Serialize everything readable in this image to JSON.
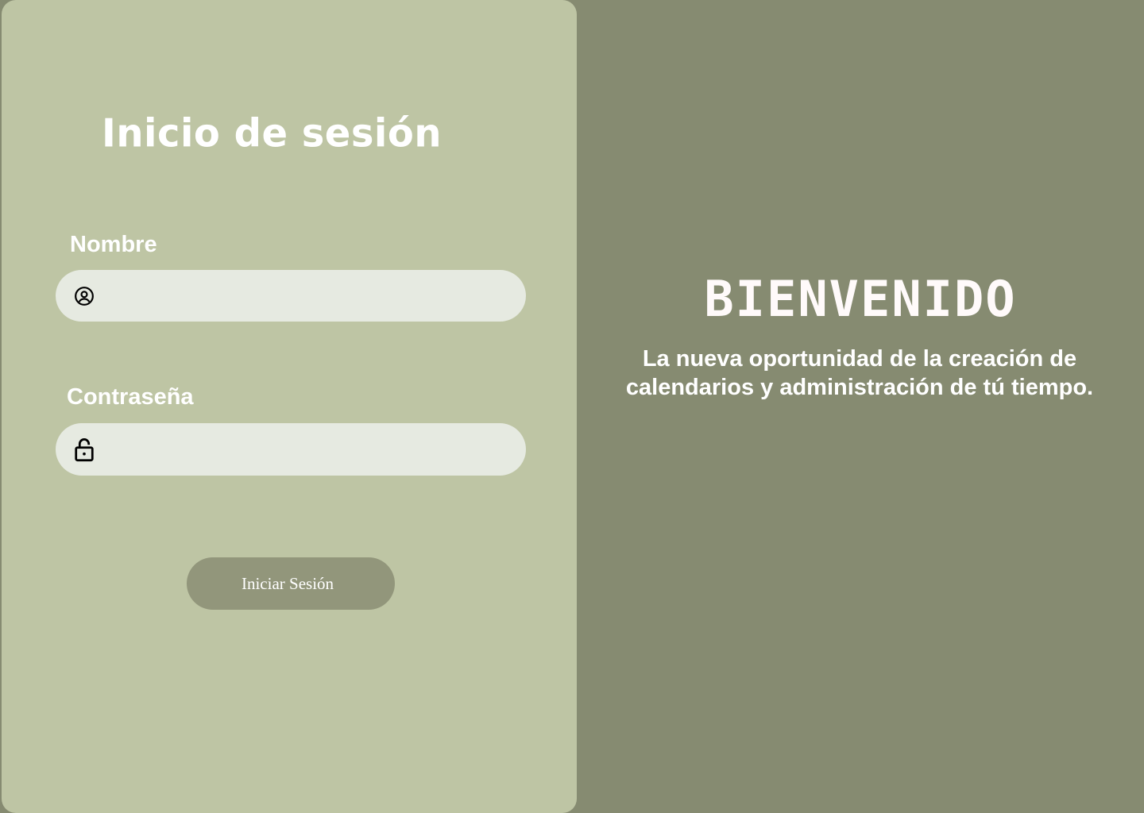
{
  "login": {
    "title": "Inicio de sesión",
    "username_label": "Nombre",
    "username_value": "",
    "username_icon": "user-circle-icon",
    "password_label": "Contraseña",
    "password_value": "",
    "password_icon": "lock-icon",
    "submit_label": "Iniciar Sesión"
  },
  "welcome": {
    "title": "BIENVENIDO",
    "subtitle": "La nueva oportunidad de la creación de calendarios y administración de tú tiempo."
  },
  "colors": {
    "background": "#868B71",
    "panel": "#BEC5A4",
    "input_bg": "#E6EAE1",
    "button_bg": "#92967B",
    "text": "#FFFFFF"
  }
}
